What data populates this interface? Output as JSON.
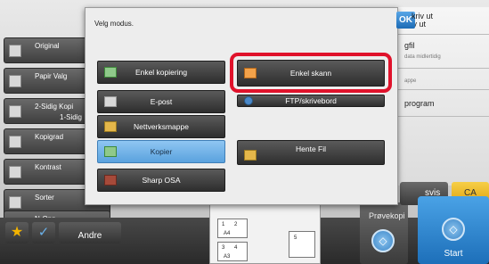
{
  "sidebar": {
    "items": [
      {
        "label": "Original",
        "sub": ""
      },
      {
        "label": "Papir Valg",
        "sub": ""
      },
      {
        "label": "2-Sidig Kopi",
        "sub": "1-Sidig"
      },
      {
        "label": "Kopigrad",
        "sub": ""
      },
      {
        "label": "Kontrast",
        "sub": ""
      },
      {
        "label": "Sorter",
        "sub": ""
      },
      {
        "label": "N-Opp",
        "sub": ""
      }
    ]
  },
  "right_panel": {
    "skriv_ut": "kriv ut",
    "fil_label": "gfil",
    "fil_sub": "data midlertidig",
    "mappe_sub": "appe",
    "program_label": "program"
  },
  "dialog": {
    "title": "Velg modus.",
    "ok_label": "OK",
    "modes": {
      "enkel_kopiering": "Enkel kopiering",
      "enkel_skann": "Enkel skann",
      "epost": "E-post",
      "ftp": "FTP/skrivebord",
      "nettverksmappe": "Nettverksmappe",
      "kopier": "Kopier",
      "hente_fil": "Hente Fil",
      "sharp_osa": "Sharp OSA"
    },
    "selected": "kopier"
  },
  "bottom": {
    "andre_label": "Andre",
    "provekopi_label": "Prøvekopi",
    "start_label": "Start",
    "ca_label": "CA",
    "tilbakestill_label": "svis",
    "preview": {
      "p1": "1",
      "p2": "2",
      "p3": "3",
      "p4": "4",
      "p5": "5",
      "a4": "A4",
      "a3": "A3"
    }
  },
  "colors": {
    "highlight": "#e0122b",
    "selected_mode": "#6fb1e6",
    "start": "#2a85d0",
    "ca": "#eab52a"
  }
}
